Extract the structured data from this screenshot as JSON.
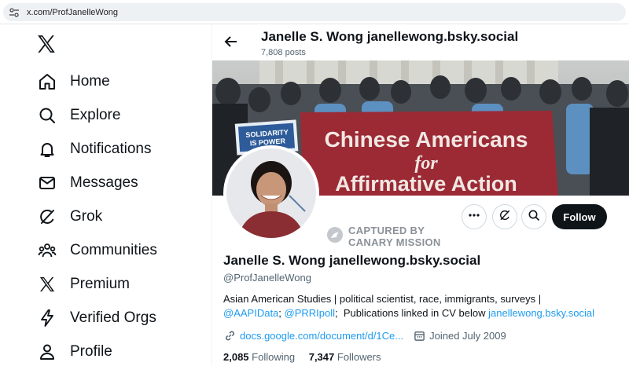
{
  "browser": {
    "url": "x.com/ProfJanelleWong"
  },
  "nav": {
    "logo_icon": "x-logo-icon",
    "items": [
      {
        "label": "Home",
        "icon": "home-icon"
      },
      {
        "label": "Explore",
        "icon": "search-icon"
      },
      {
        "label": "Notifications",
        "icon": "bell-icon"
      },
      {
        "label": "Messages",
        "icon": "mail-icon"
      },
      {
        "label": "Grok",
        "icon": "grok-icon"
      },
      {
        "label": "Communities",
        "icon": "communities-icon"
      },
      {
        "label": "Premium",
        "icon": "x-logo-icon"
      },
      {
        "label": "Verified Orgs",
        "icon": "lightning-icon"
      },
      {
        "label": "Profile",
        "icon": "person-icon"
      }
    ]
  },
  "header": {
    "title": "Janelle S. Wong janellewong.bsky.social",
    "posts": "7,808 posts"
  },
  "banner": {
    "sign_main_line1": "Chinese Americans",
    "sign_main_line2": "for",
    "sign_main_line3": "Affirmative Action",
    "sign_small_line1": "SOLIDARITY",
    "sign_small_line2": "IS POWER"
  },
  "watermark": {
    "line1": "CAPTURED BY",
    "line2": "CANARY MISSION"
  },
  "actions": {
    "follow_label": "Follow"
  },
  "profile": {
    "name": "Janelle S. Wong janellewong.bsky.social",
    "handle": "@ProfJanelleWong",
    "bio_text1": "Asian American Studies  | political scientist, race, immigrants, surveys |",
    "bio_link1": "@AAPIData",
    "bio_sep": "; ",
    "bio_link2": "@PRRIpoll",
    "bio_text2": ";  Publications linked in CV below ",
    "bio_link3": "janellewong.bsky.social",
    "website": "docs.google.com/document/d/1Ce...",
    "joined": "Joined July 2009",
    "following_count": "2,085",
    "following_label": "Following",
    "followers_count": "7,347",
    "followers_label": "Followers"
  },
  "colors": {
    "accent": "#1d9bf0",
    "follow_bg": "#0f1419",
    "banner_sign": "#9b2a35"
  }
}
